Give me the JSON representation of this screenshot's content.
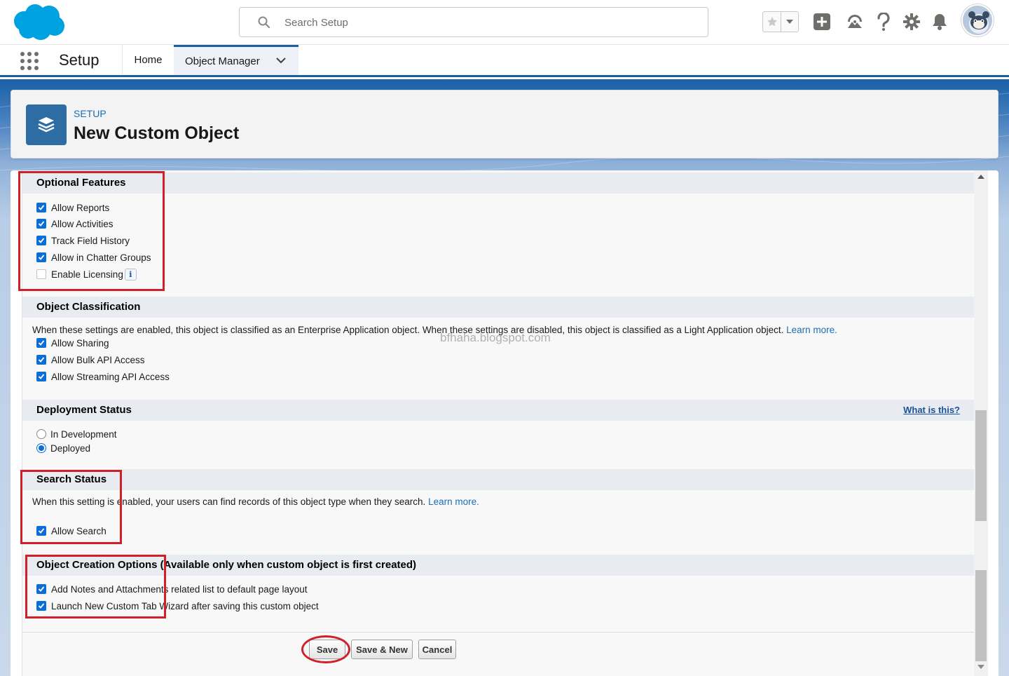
{
  "header": {
    "search_placeholder": "Search Setup"
  },
  "context_bar": {
    "app_name": "Setup",
    "tabs": [
      {
        "label": "Home"
      },
      {
        "label": "Object Manager"
      }
    ]
  },
  "page_header": {
    "eyebrow": "SETUP",
    "title": "New Custom Object"
  },
  "sections": {
    "optional_features": {
      "title": "Optional Features",
      "items": [
        {
          "label": "Allow Reports",
          "checked": true
        },
        {
          "label": "Allow Activities",
          "checked": true
        },
        {
          "label": "Track Field History",
          "checked": true
        },
        {
          "label": "Allow in Chatter Groups",
          "checked": true
        },
        {
          "label": "Enable Licensing",
          "checked": false
        }
      ],
      "info_label": "i"
    },
    "object_classification": {
      "title": "Object Classification",
      "description": "When these settings are enabled, this object is classified as an Enterprise Application object. When these settings are disabled, this object is classified as a Light Application object.",
      "learn_more": "Learn more.",
      "items": [
        {
          "label": "Allow Sharing",
          "checked": true
        },
        {
          "label": "Allow Bulk API Access",
          "checked": true
        },
        {
          "label": "Allow Streaming API Access",
          "checked": true
        }
      ]
    },
    "deployment_status": {
      "title": "Deployment Status",
      "help_link": "What is this?",
      "options": [
        {
          "label": "In Development",
          "selected": false
        },
        {
          "label": "Deployed",
          "selected": true
        }
      ]
    },
    "search_status": {
      "title": "Search Status",
      "description": "When this setting is enabled, your users can find records of this object type when they search.",
      "learn_more": "Learn more.",
      "items": [
        {
          "label": "Allow Search",
          "checked": true
        }
      ]
    },
    "object_creation_options": {
      "title": "Object Creation Options (Available only when custom object is first created)",
      "items": [
        {
          "label": "Add Notes and Attachments related list to default page layout",
          "checked": true
        },
        {
          "label": "Launch New Custom Tab Wizard after saving this custom object",
          "checked": true
        }
      ]
    }
  },
  "buttons": {
    "save": "Save",
    "save_new": "Save & New",
    "cancel": "Cancel"
  },
  "watermark": "bfhaha.blogspot.com",
  "colors": {
    "brand_blue": "#1b5f9e",
    "checkbox_blue": "#0b6ed8",
    "annotation_red": "#d0202a",
    "salesforce_cloud": "#00a1e0"
  },
  "icons": {
    "logo": "salesforce-cloud-logo",
    "search": "search-icon",
    "favorites": "star-icon",
    "favorites_menu": "caret-down-icon",
    "global_actions": "plus-icon",
    "trailhead": "trailhead-icon",
    "help": "question-icon",
    "setup": "gear-icon",
    "notifications": "bell-icon",
    "avatar": "astro-avatar",
    "app_launcher": "waffle-icon",
    "nav_menu": "chevron-down-icon",
    "object": "stacked-layers-icon"
  }
}
